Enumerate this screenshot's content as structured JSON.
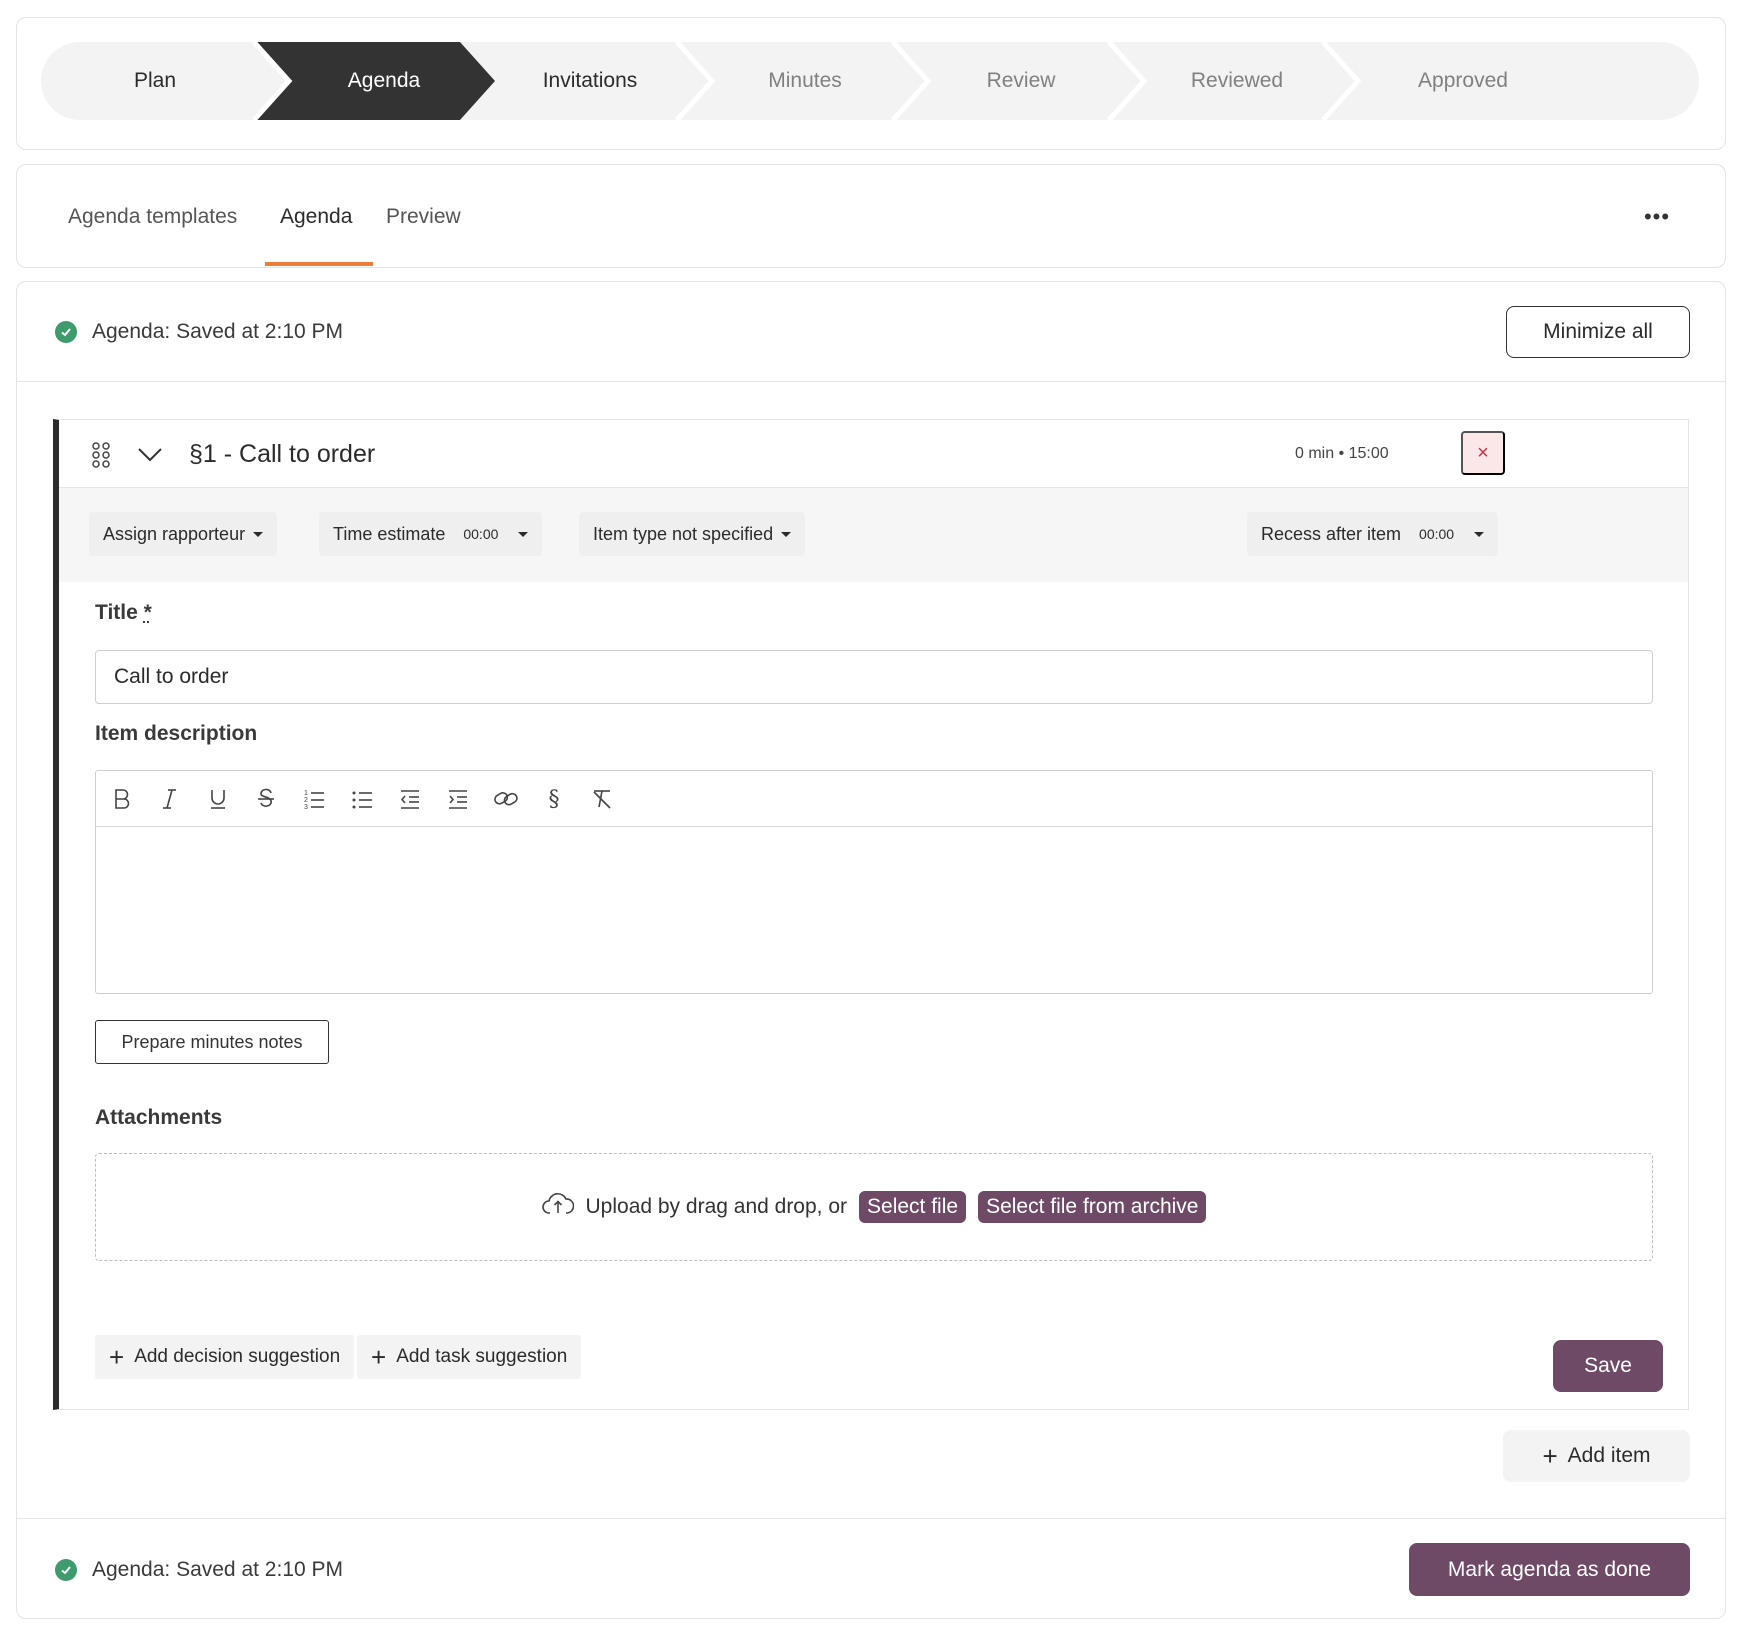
{
  "stepper": {
    "steps": [
      {
        "label": "Plan",
        "state": "done"
      },
      {
        "label": "Agenda",
        "state": "active"
      },
      {
        "label": "Invitations",
        "state": "done"
      },
      {
        "label": "Minutes",
        "state": "upcoming"
      },
      {
        "label": "Review",
        "state": "upcoming"
      },
      {
        "label": "Reviewed",
        "state": "upcoming"
      },
      {
        "label": "Approved",
        "state": "upcoming"
      }
    ]
  },
  "tabs": {
    "items": [
      {
        "label": "Agenda templates"
      },
      {
        "label": "Agenda"
      },
      {
        "label": "Preview"
      }
    ],
    "active": "Agenda",
    "more_label": "•••"
  },
  "status": {
    "top_text": "Agenda: Saved at 2:10 PM",
    "bottom_text": "Agenda: Saved at 2:10 PM",
    "minimize_label": "Minimize all",
    "mark_done_label": "Mark agenda as done"
  },
  "item": {
    "title_heading": "§1 - Call to order",
    "time_summary": "0 min • 15:00",
    "remove_label": "×",
    "assign_rapporteur": "Assign rapporteur",
    "time_estimate_label": "Time estimate",
    "time_estimate_value": "00:00",
    "item_type": "Item type not specified",
    "recess_label": "Recess after item",
    "recess_value": "00:00",
    "title_label": "Title",
    "title_required": "*",
    "title_value": "Call to order",
    "description_label": "Item description",
    "prepare_minutes_label": "Prepare minutes notes",
    "attachments_label": "Attachments",
    "upload_text": "Upload by drag and drop, or",
    "select_file": "Select file",
    "select_archive": "Select file from archive",
    "add_decision": "Add decision suggestion",
    "add_task": "Add task suggestion",
    "save_label": "Save"
  },
  "add_item_label": "Add item",
  "colors": {
    "accent": "#ef7d3a",
    "primary": "#6e4a66",
    "active_step": "#333333",
    "success": "#3f9a6c",
    "danger": "#c0364a"
  }
}
